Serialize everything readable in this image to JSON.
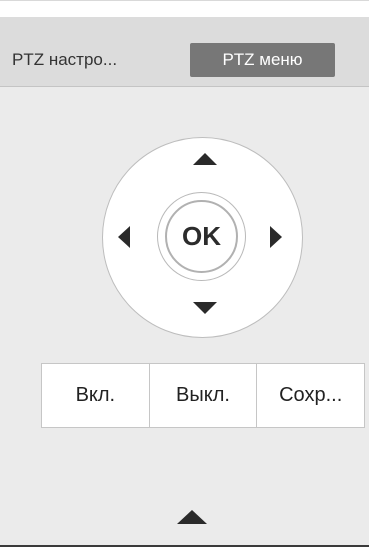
{
  "tabs": {
    "ptz_settings": "PTZ настро...",
    "ptz_menu": "PTZ меню"
  },
  "dpad": {
    "ok_label": "OK",
    "up_icon": "arrow-up-icon",
    "down_icon": "arrow-down-icon",
    "left_icon": "arrow-left-icon",
    "right_icon": "arrow-right-icon"
  },
  "buttons": {
    "on_label": "Вкл.",
    "off_label": "Выкл.",
    "save_label": "Сохр..."
  },
  "footer": {
    "collapse_icon": "arrow-up-icon"
  },
  "colors": {
    "active_tab_bg": "#777777",
    "panel_bg": "#ebebeb",
    "tabbar_bg": "#dcdcdc"
  }
}
